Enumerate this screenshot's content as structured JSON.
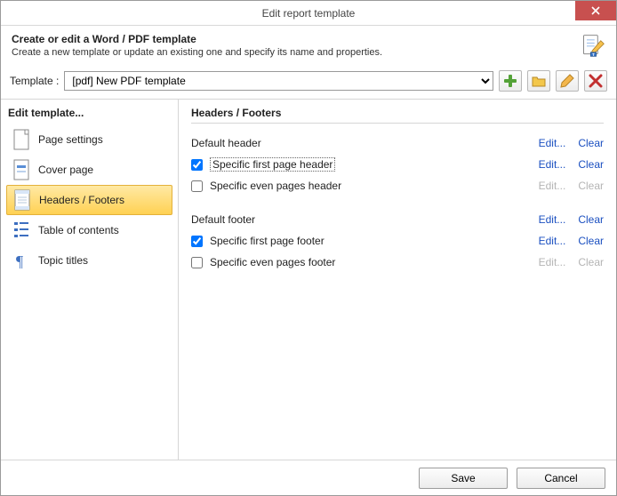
{
  "window": {
    "title": "Edit report template"
  },
  "header": {
    "title": "Create or edit a Word / PDF template",
    "subtitle": "Create a new template or update an existing one and specify its name and properties."
  },
  "template": {
    "label": "Template :",
    "selected": "[pdf] New PDF template"
  },
  "sidebar": {
    "title": "Edit template...",
    "items": [
      {
        "label": "Page settings"
      },
      {
        "label": "Cover page"
      },
      {
        "label": "Headers / Footers"
      },
      {
        "label": "Table of contents"
      },
      {
        "label": "Topic titles"
      }
    ],
    "selected_index": 2
  },
  "content": {
    "title": "Headers / Footers",
    "groups": [
      {
        "label": "Default header",
        "edit_enabled": true,
        "clear_enabled": true,
        "rows": [
          {
            "label": "Specific first page header",
            "checked": true,
            "edit_enabled": true,
            "clear_enabled": true,
            "focused": true
          },
          {
            "label": "Specific even pages header",
            "checked": false,
            "edit_enabled": false,
            "clear_enabled": false
          }
        ]
      },
      {
        "label": "Default footer",
        "edit_enabled": true,
        "clear_enabled": true,
        "rows": [
          {
            "label": "Specific first page footer",
            "checked": true,
            "edit_enabled": true,
            "clear_enabled": true
          },
          {
            "label": "Specific even pages footer",
            "checked": false,
            "edit_enabled": false,
            "clear_enabled": false
          }
        ]
      }
    ],
    "link_edit": "Edit...",
    "link_clear": "Clear"
  },
  "footer": {
    "save": "Save",
    "cancel": "Cancel"
  }
}
